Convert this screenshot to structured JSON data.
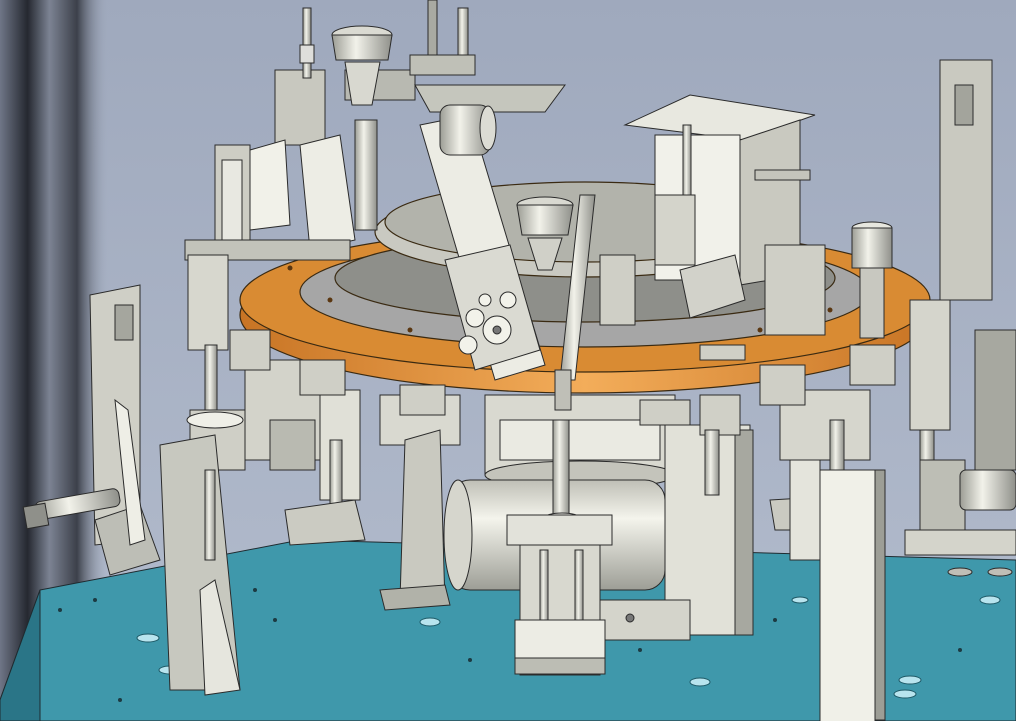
{
  "scene": {
    "subject": "rotary-indexing-assembly-machine-cad-render",
    "colors": {
      "background": "#a9b3c6",
      "table_top": "#3f98ab",
      "table_front": "#2a7587",
      "index_plate": "#d9822b",
      "index_plate_edge": "#f0a84a",
      "steel_light": "#e4e4dc",
      "steel_mid": "#c4c4bb",
      "steel_dark": "#8d8f88",
      "outline": "#2b2b2b"
    }
  }
}
